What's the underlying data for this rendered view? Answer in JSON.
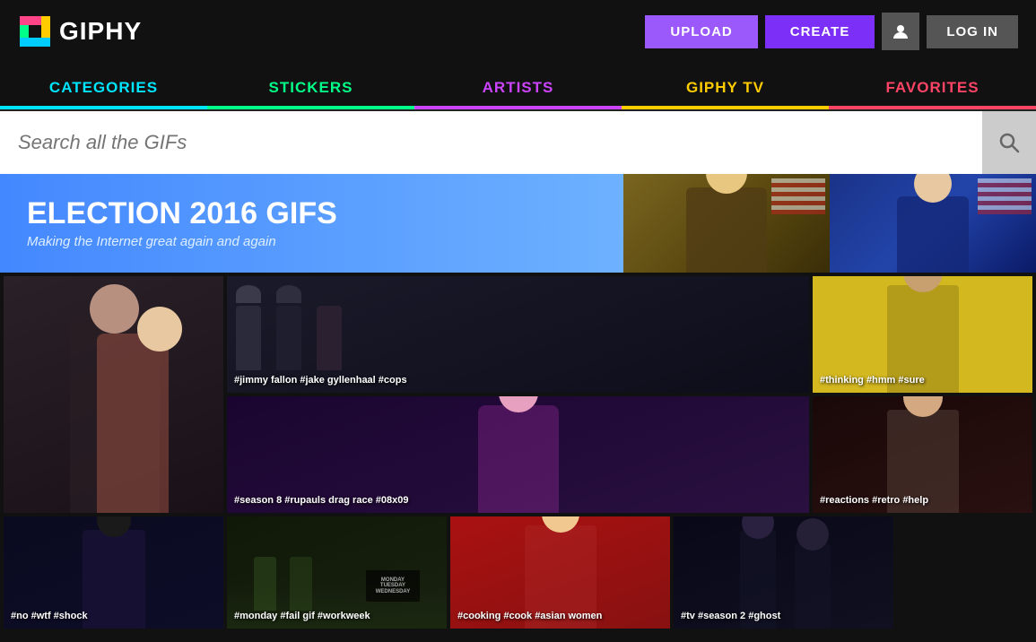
{
  "header": {
    "logo_text": "GIPHY",
    "upload_label": "UPLOAD",
    "create_label": "CREATE",
    "login_label": "LOG IN"
  },
  "nav": {
    "tabs": [
      {
        "id": "categories",
        "label": "CATEGORIES",
        "color": "#00e5ff"
      },
      {
        "id": "stickers",
        "label": "STICKERS",
        "color": "#00ff88"
      },
      {
        "id": "artists",
        "label": "ARTISTS",
        "color": "#cc44ff"
      },
      {
        "id": "giphytv",
        "label": "GIPHY TV",
        "color": "#ffcc00"
      },
      {
        "id": "favorites",
        "label": "FAVORITES",
        "color": "#ff4466"
      }
    ]
  },
  "search": {
    "placeholder": "Search all the GIFs"
  },
  "banner": {
    "title": "ELECTION 2016 GIFS",
    "subtitle": "Making the Internet great again and again"
  },
  "gifs": {
    "row1": [
      {
        "id": "cops",
        "tags": "#jimmy fallon #jake gyllenhaal #cops"
      },
      {
        "id": "couple",
        "tags": ""
      },
      {
        "id": "thinking",
        "tags": "#thinking #hmm #sure"
      }
    ],
    "row2": [
      {
        "id": "drag",
        "tags": "#season 8 #rupauls drag race #08x09"
      },
      {
        "id": "reactions",
        "tags": "#reactions #retro #help"
      }
    ],
    "row3": [
      {
        "id": "shock",
        "tags": "#no #wtf #shock"
      },
      {
        "id": "monday",
        "tags": "#monday #fail gif #workweek"
      },
      {
        "id": "cooking",
        "tags": "#cooking #cook #asian women"
      },
      {
        "id": "ghost",
        "tags": "#tv #season 2 #ghost"
      }
    ]
  }
}
